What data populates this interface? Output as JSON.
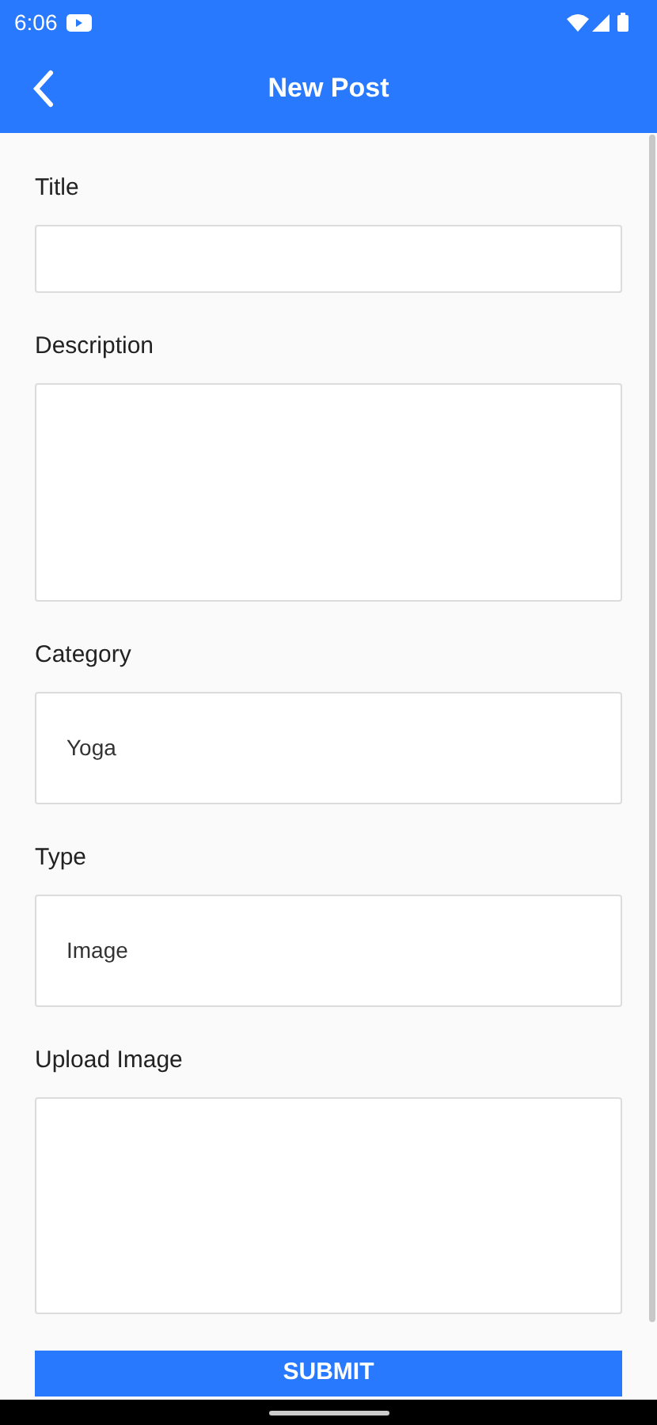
{
  "status_bar": {
    "time": "6:06"
  },
  "app_bar": {
    "title": "New Post"
  },
  "fields": [
    {
      "kind": "text",
      "label": "Title"
    },
    {
      "kind": "textarea",
      "label": "Description"
    },
    {
      "kind": "select",
      "label": "Category",
      "value": "Yoga"
    },
    {
      "kind": "select",
      "label": "Type",
      "value": "Image"
    },
    {
      "kind": "upload",
      "label": "Upload Image"
    }
  ],
  "submit": {
    "label": "SUBMIT"
  }
}
